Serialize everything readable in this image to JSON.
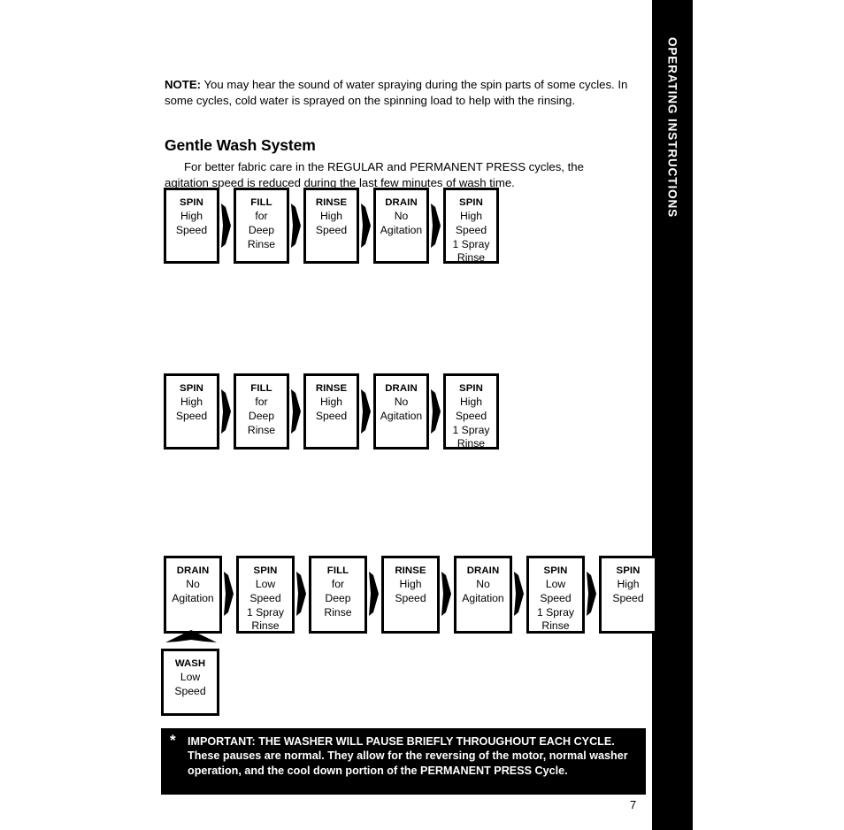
{
  "page": {
    "number": "7",
    "side_tab_label": "OPERATING INSTRUCTIONS"
  },
  "note": {
    "label": "NOTE:",
    "text": " You may hear the sound of water spraying during the spin parts of some cycles. In some cycles, cold water is sprayed on the spinning load to help with the rinsing."
  },
  "section": {
    "heading": "Gentle Wash System",
    "intro": "For better fabric care in the REGULAR and PERMANENT PRESS cycles, the agitation speed is reduced during the last few minutes of wash time."
  },
  "diagrams": [
    {
      "id": "cycle-row-1",
      "steps": [
        {
          "title": "SPIN",
          "lines": [
            "High",
            "Speed"
          ]
        },
        {
          "title": "FILL",
          "lines": [
            "for",
            "Deep",
            "Rinse"
          ]
        },
        {
          "title": "RINSE",
          "lines": [
            "High",
            "Speed"
          ]
        },
        {
          "title": "DRAIN",
          "lines": [
            "No",
            "Agitation"
          ]
        },
        {
          "title": "SPIN",
          "lines": [
            "High",
            "Speed",
            "1 Spray",
            "Rinse"
          ]
        }
      ]
    },
    {
      "id": "cycle-row-2",
      "steps": [
        {
          "title": "SPIN",
          "lines": [
            "High",
            "Speed"
          ]
        },
        {
          "title": "FILL",
          "lines": [
            "for",
            "Deep",
            "Rinse"
          ]
        },
        {
          "title": "RINSE",
          "lines": [
            "High",
            "Speed"
          ]
        },
        {
          "title": "DRAIN",
          "lines": [
            "No",
            "Agitation"
          ]
        },
        {
          "title": "SPIN",
          "lines": [
            "High",
            "Speed",
            "1 Spray",
            "Rinse"
          ]
        }
      ]
    },
    {
      "id": "cycle-row-3",
      "steps": [
        {
          "title": "DRAIN",
          "lines": [
            "No",
            "Agitation"
          ]
        },
        {
          "title": "SPIN",
          "lines": [
            "Low",
            "Speed",
            "1 Spray",
            "Rinse"
          ]
        },
        {
          "title": "FILL",
          "lines": [
            "for",
            "Deep",
            "Rinse"
          ]
        },
        {
          "title": "RINSE",
          "lines": [
            "High",
            "Speed"
          ]
        },
        {
          "title": "DRAIN",
          "lines": [
            "No",
            "Agitation"
          ]
        },
        {
          "title": "SPIN",
          "lines": [
            "Low",
            "Speed",
            "1 Spray",
            "Rinse"
          ]
        },
        {
          "title": "SPIN",
          "lines": [
            "High",
            "Speed"
          ]
        }
      ]
    }
  ],
  "wash_box": {
    "title": "WASH",
    "lines": [
      "Low",
      "Speed"
    ]
  },
  "important": {
    "marker": "*",
    "line1": "IMPORTANT: THE WASHER WILL PAUSE BRIEFLY THROUGHOUT EACH CYCLE.",
    "line2": "These pauses are normal. They allow for the reversing of the motor, normal washer operation, and the cool down portion of the PERMANENT PRESS Cycle."
  },
  "colors": {
    "ink": "#000000",
    "paper": "#ffffff"
  }
}
